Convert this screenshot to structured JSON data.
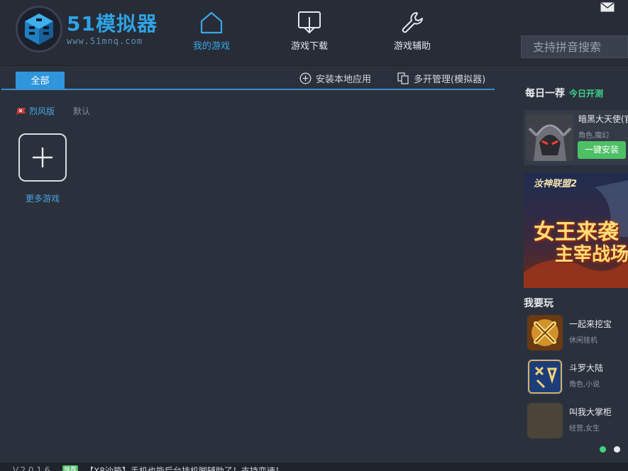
{
  "header": {
    "logo_title": "51模拟器",
    "logo_url": "www.51mnq.com",
    "nav": [
      {
        "label": "我的游戏",
        "icon": "home-icon",
        "active": true
      },
      {
        "label": "游戏下载",
        "icon": "download-icon",
        "active": false
      },
      {
        "label": "游戏辅助",
        "icon": "wrench-icon",
        "active": false
      }
    ],
    "search_placeholder": "支持拼音搜索",
    "mail_icon": "mail-icon"
  },
  "toolbar": {
    "tab_all": "全部",
    "install_local": "安装本地应用",
    "multi_manage": "多开管理(模拟器)"
  },
  "filters": {
    "liefeng": "烈风版",
    "default": "默认"
  },
  "main": {
    "add_more_label": "更多游戏"
  },
  "sidebar": {
    "daily_title": "每日一荐",
    "daily_sub": "今日开测",
    "featured": {
      "name": "暗黑大天使(官",
      "tag": "角色,魔幻",
      "install_label": "一键安装"
    },
    "banner": {
      "top": "汝神联盟2",
      "line1": "女王来袭",
      "line2": "主宰战场"
    },
    "play_title": "我要玩",
    "games": [
      {
        "name": "一起来挖宝",
        "tag": "休闲挂机"
      },
      {
        "name": "斗罗大陆",
        "tag": "角色,小说"
      },
      {
        "name": "叫我大掌柜",
        "tag": "经营,女生"
      }
    ],
    "dots": [
      {
        "color": "#3fd47a"
      },
      {
        "color": "#e8eaee"
      }
    ]
  },
  "statusbar": {
    "version": "V.2.0.1.6",
    "badge": "推荐",
    "news": "【X8沙箱】手机也能后台挂机脚辅助了！支持变速！"
  },
  "colors": {
    "accent": "#2f96db",
    "green": "#4fbf66",
    "bg": "#2b313c"
  }
}
